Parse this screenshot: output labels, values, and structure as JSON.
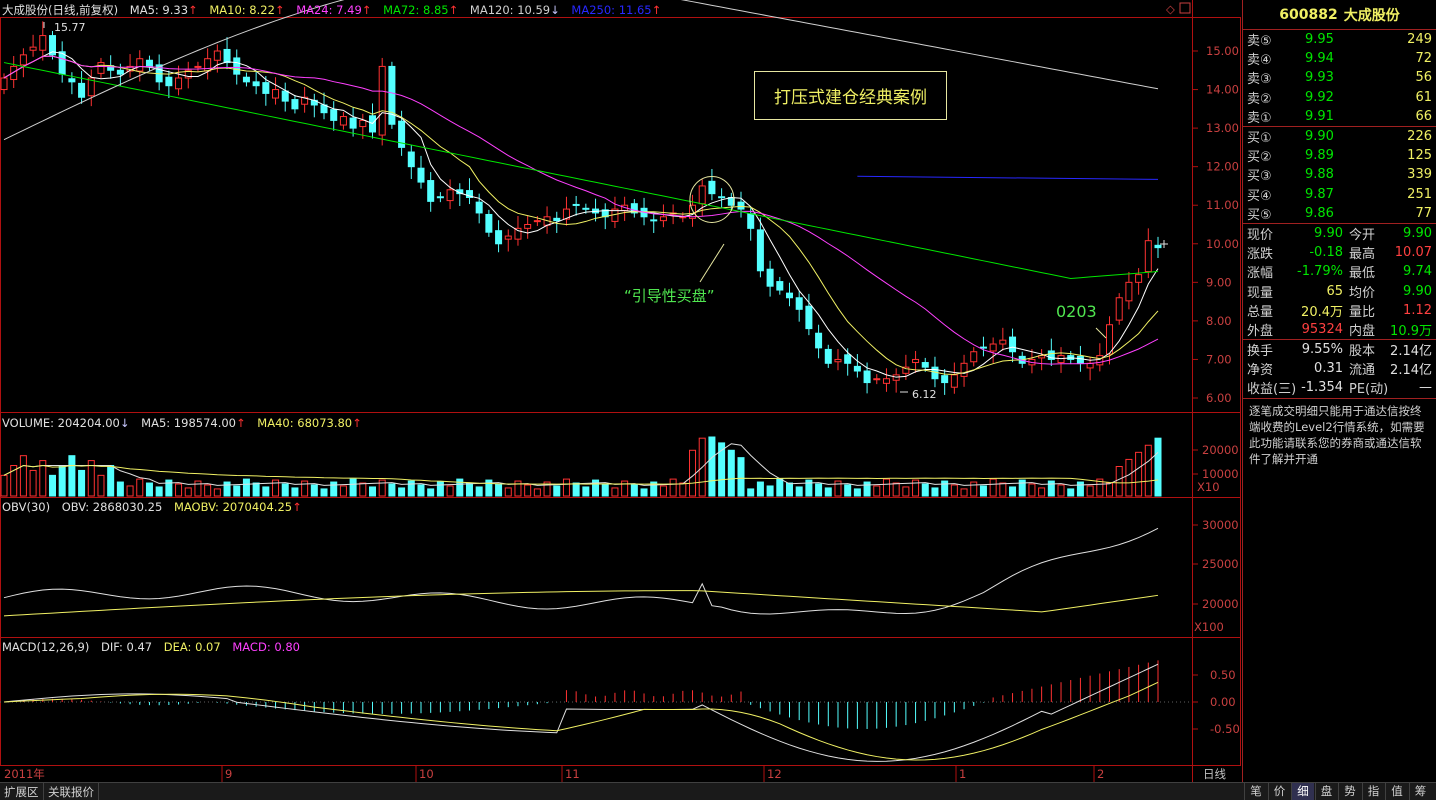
{
  "app": {
    "stock_name_title": "大成股份(日线,前复权)"
  },
  "price_legend": {
    "ma5": "MA5: 9.33",
    "ma10": "MA10: 8.22",
    "ma24": "MA24: 7.49",
    "ma72": "MA72: 8.85",
    "ma120": "MA120: 10.59",
    "ma250": "MA250: 11.65"
  },
  "volume_legend": {
    "vol": "VOLUME: 204204.00",
    "ma5": "MA5: 198574.00",
    "ma40": "MA40: 68073.80"
  },
  "obv_legend": {
    "title": "OBV(30)",
    "obv": "OBV: 2868030.25",
    "maobv": "MAOBV: 2070404.25"
  },
  "macd_legend": {
    "title": "MACD(12,26,9)",
    "dif": "DIF: 0.47",
    "dea": "DEA: 0.07",
    "macd": "MACD: 0.80"
  },
  "price_axis": [
    "15.00",
    "14.00",
    "13.00",
    "12.00",
    "11.00",
    "10.00",
    "9.00",
    "8.00",
    "7.00",
    "6.00"
  ],
  "volume_axis": [
    "20000",
    "10000"
  ],
  "volume_unit": "X10",
  "obv_axis": [
    "30000",
    "25000",
    "20000"
  ],
  "obv_unit": "X100",
  "macd_axis": [
    "0.50",
    "0.00",
    "-0.50"
  ],
  "date_axis": {
    "year": "2011年",
    "labels": [
      "9",
      "10",
      "11",
      "12",
      "1",
      "2"
    ],
    "period": "日线"
  },
  "annotations": {
    "title_box": "打压式建仓经典案例",
    "induce_buy": "“引导性买盘”",
    "date_mark": "0203",
    "high_label": "15.77",
    "low_label": "6.12"
  },
  "colors": {
    "up": "#ff3232",
    "down": "#54ffff",
    "ma5": "#ffffff",
    "ma10": "#f0f064",
    "ma24": "#ff40ff",
    "ma72": "#00e600",
    "ma120": "#d0d0d0",
    "ma250": "#2828ff"
  },
  "right_panel": {
    "code": "600882",
    "name": "大成股份",
    "asks": [
      {
        "label": "卖⑤",
        "price": "9.95",
        "vol": "249"
      },
      {
        "label": "卖④",
        "price": "9.94",
        "vol": "72"
      },
      {
        "label": "卖③",
        "price": "9.93",
        "vol": "56"
      },
      {
        "label": "卖②",
        "price": "9.92",
        "vol": "61"
      },
      {
        "label": "卖①",
        "price": "9.91",
        "vol": "66"
      }
    ],
    "bids": [
      {
        "label": "买①",
        "price": "9.90",
        "vol": "226"
      },
      {
        "label": "买②",
        "price": "9.89",
        "vol": "125"
      },
      {
        "label": "买③",
        "price": "9.88",
        "vol": "339"
      },
      {
        "label": "买④",
        "price": "9.87",
        "vol": "251"
      },
      {
        "label": "买⑤",
        "price": "9.86",
        "vol": "77"
      }
    ],
    "quote": [
      {
        "l1": "现价",
        "v1": "9.90",
        "c1": "green",
        "l2": "今开",
        "v2": "9.90",
        "c2": "green"
      },
      {
        "l1": "涨跌",
        "v1": "-0.18",
        "c1": "green",
        "l2": "最高",
        "v2": "10.07",
        "c2": "red"
      },
      {
        "l1": "涨幅",
        "v1": "-1.79%",
        "c1": "green",
        "l2": "最低",
        "v2": "9.74",
        "c2": "green"
      },
      {
        "l1": "现量",
        "v1": "65",
        "c1": "yellow",
        "l2": "均价",
        "v2": "9.90",
        "c2": "green"
      },
      {
        "l1": "总量",
        "v1": "20.4万",
        "c1": "yellow",
        "l2": "量比",
        "v2": "1.12",
        "c2": "red"
      },
      {
        "l1": "外盘",
        "v1": "95324",
        "c1": "red",
        "l2": "内盘",
        "v2": "10.9万",
        "c2": "green"
      }
    ],
    "fundamentals": [
      {
        "l1": "换手",
        "v1": "9.55%",
        "l2": "股本",
        "v2": "2.14亿"
      },
      {
        "l1": "净资",
        "v1": "0.31",
        "l2": "流通",
        "v2": "2.14亿"
      },
      {
        "l1": "收益(三)",
        "v1": "-1.354",
        "l2": "PE(动)",
        "v2": "—"
      }
    ],
    "notice": "逐笔成交明细只能用于通达信按终端收费的Level2行情系统，如需要此功能请联系您的券商或通达信软件了解并开通"
  },
  "bottom_bar": {
    "left_tabs": [
      "扩展区",
      "关联报价"
    ],
    "right_tabs": [
      "笔",
      "价",
      "细",
      "盘",
      "势",
      "指",
      "值",
      "筹"
    ],
    "active_right_tab": "细"
  },
  "chart_data": {
    "type": "candlestick",
    "note_axis": "price",
    "closes": [
      14.3,
      14.6,
      14.9,
      15.1,
      15.4,
      14.9,
      14.4,
      14.2,
      13.8,
      14.3,
      14.7,
      14.5,
      14.4,
      14.6,
      14.8,
      14.6,
      14.2,
      14.1,
      14.3,
      14.5,
      14.6,
      14.8,
      15.0,
      14.7,
      14.4,
      14.2,
      14.1,
      13.9,
      14.0,
      13.7,
      13.5,
      13.8,
      13.6,
      13.4,
      13.2,
      13.3,
      13.0,
      13.2,
      12.9,
      14.6,
      13.1,
      12.5,
      12.0,
      11.6,
      11.1,
      11.2,
      11.4,
      11.3,
      11.2,
      10.8,
      10.3,
      10.0,
      10.2,
      10.4,
      10.5,
      10.6,
      10.7,
      10.6,
      10.9,
      11.0,
      10.9,
      10.8,
      10.7,
      10.9,
      11.0,
      10.8,
      10.7,
      10.6,
      10.7,
      10.8,
      10.7,
      11.0,
      11.5,
      11.3,
      11.2,
      11.0,
      10.9,
      10.4,
      9.3,
      8.9,
      8.8,
      8.6,
      8.3,
      7.8,
      7.3,
      6.9,
      7.0,
      6.9,
      6.7,
      6.4,
      6.5,
      6.5,
      6.6,
      6.8,
      7.0,
      6.8,
      6.5,
      6.4,
      6.6,
      6.9,
      7.2,
      7.3,
      7.4,
      7.5,
      7.2,
      6.9,
      7.0,
      7.1,
      7.0,
      7.1,
      7.0,
      6.9,
      6.9,
      7.1,
      7.9,
      8.6,
      9.0,
      9.2,
      10.08,
      9.9
    ],
    "low_label": "6.12",
    "high_label": "15.77"
  }
}
